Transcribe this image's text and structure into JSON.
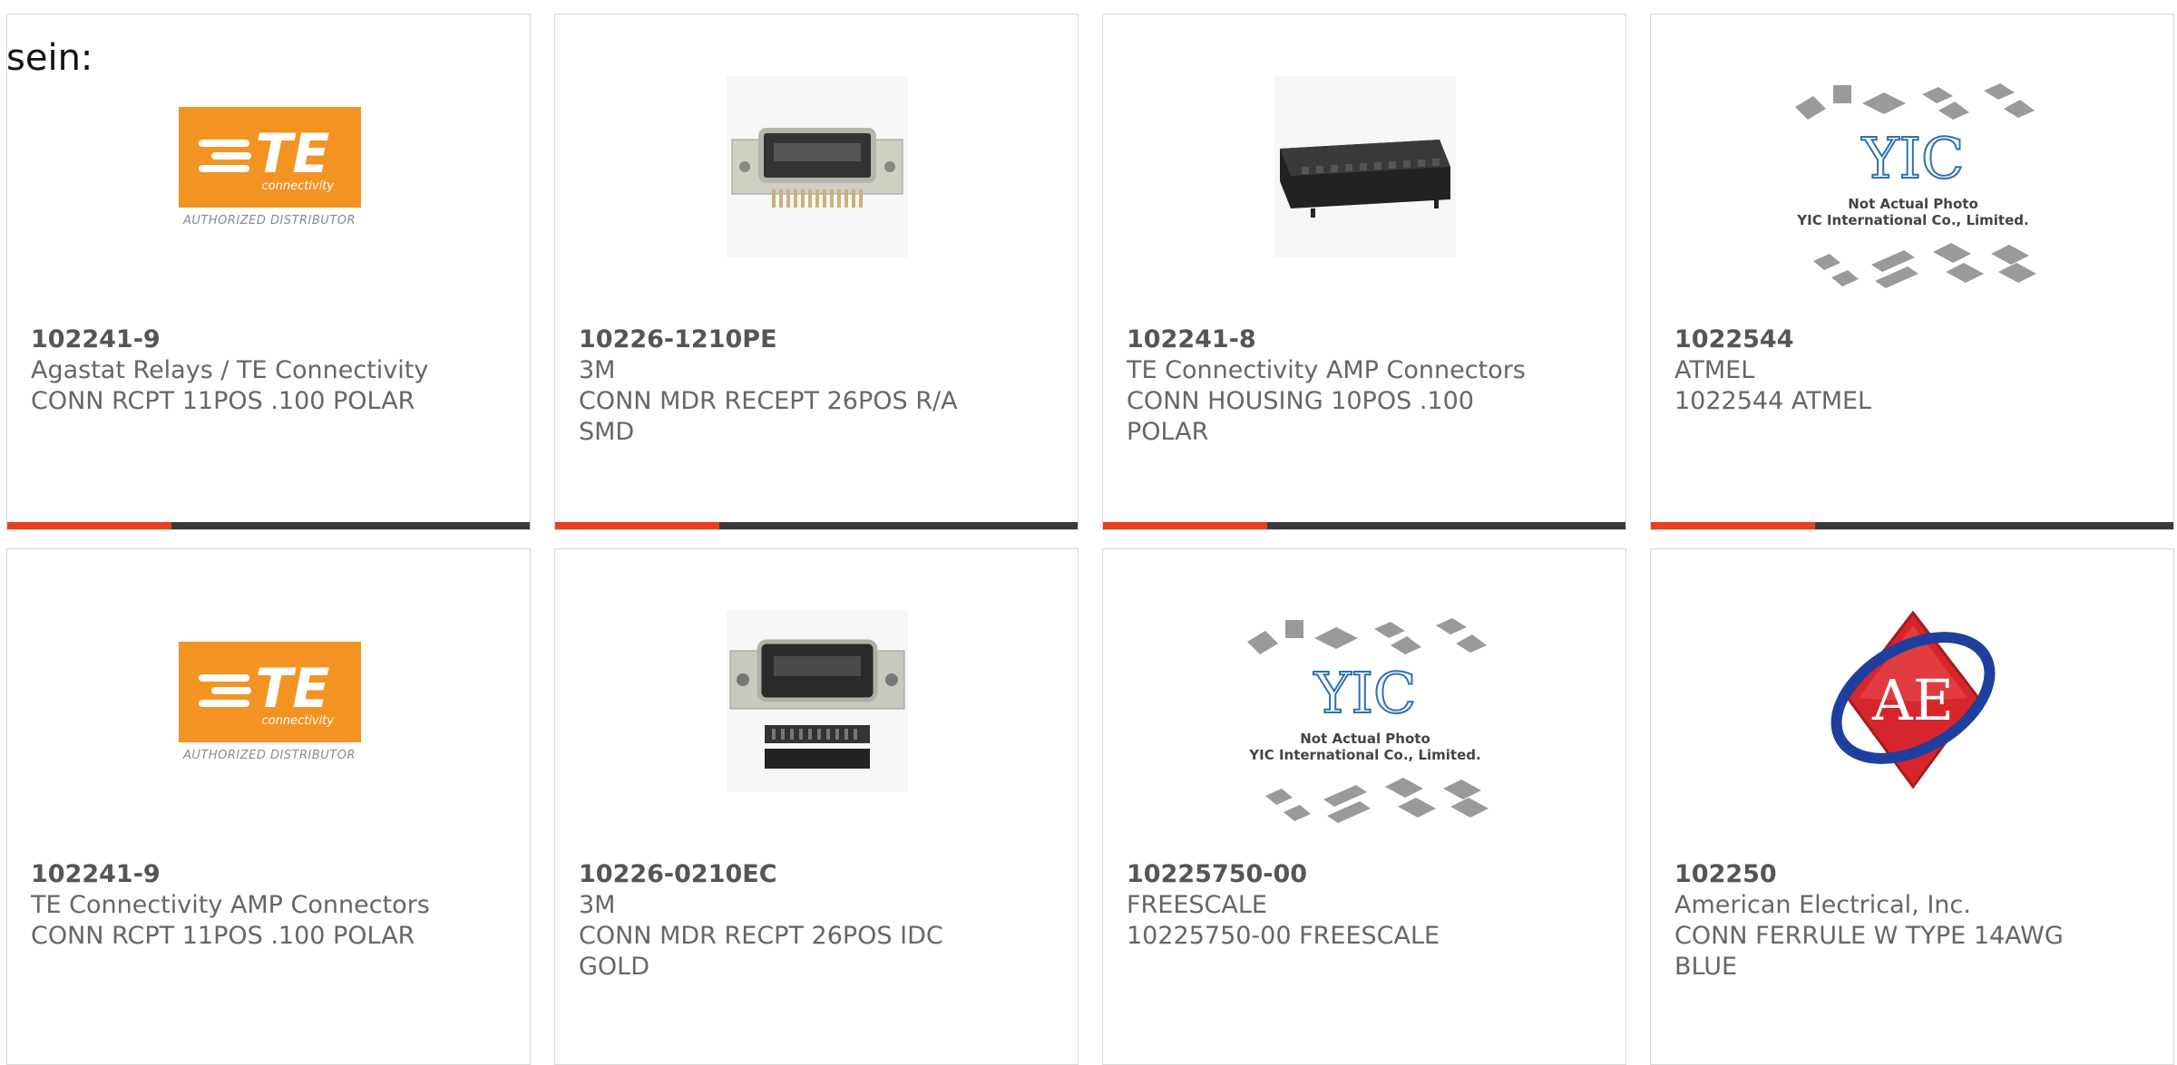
{
  "lead_text": "sein:",
  "te_logo": {
    "letters": "TE",
    "sub": "connectivity",
    "tagline": "AUTHORIZED DISTRIBUTOR"
  },
  "yic_logo": {
    "mark": "YIC",
    "line1": "Not Actual Photo",
    "line2": "YIC International Co., Limited."
  },
  "ae_logo": {
    "letters": "AE"
  },
  "products": [
    {
      "part": "102241-9",
      "manufacturer": "Agastat Relays / TE Connectivity",
      "description": "CONN RCPT 11POS .100 POLAR",
      "image": "te-logo"
    },
    {
      "part": "10226-1210PE",
      "manufacturer": "3M",
      "description": "CONN MDR RECEPT 26POS R/A\nSMD",
      "image": "connector-photo"
    },
    {
      "part": "102241-8",
      "manufacturer": "TE Connectivity AMP Connectors",
      "description": "CONN HOUSING 10POS .100\nPOLAR",
      "image": "housing-photo"
    },
    {
      "part": "1022544",
      "manufacturer": "ATMEL",
      "description": "1022544 ATMEL",
      "image": "yic-placeholder"
    },
    {
      "part": "102241-9",
      "manufacturer": "TE Connectivity AMP Connectors",
      "description": "CONN RCPT 11POS .100 POLAR",
      "image": "te-logo"
    },
    {
      "part": "10226-0210EC",
      "manufacturer": "3M",
      "description": "CONN MDR RECPT 26POS IDC\nGOLD",
      "image": "connector-photo"
    },
    {
      "part": "10225750-00",
      "manufacturer": "FREESCALE",
      "description": "10225750-00 FREESCALE",
      "image": "yic-placeholder"
    },
    {
      "part": "102250",
      "manufacturer": "American Electrical, Inc.",
      "description": "CONN FERRULE W TYPE 14AWG\nBLUE",
      "image": "ae-logo"
    }
  ],
  "colors": {
    "accent": "#e8401c",
    "bar": "#3a3a3a",
    "te_orange": "#f39322",
    "ae_red": "#d7262b",
    "ae_blue": "#1f3f9e"
  }
}
